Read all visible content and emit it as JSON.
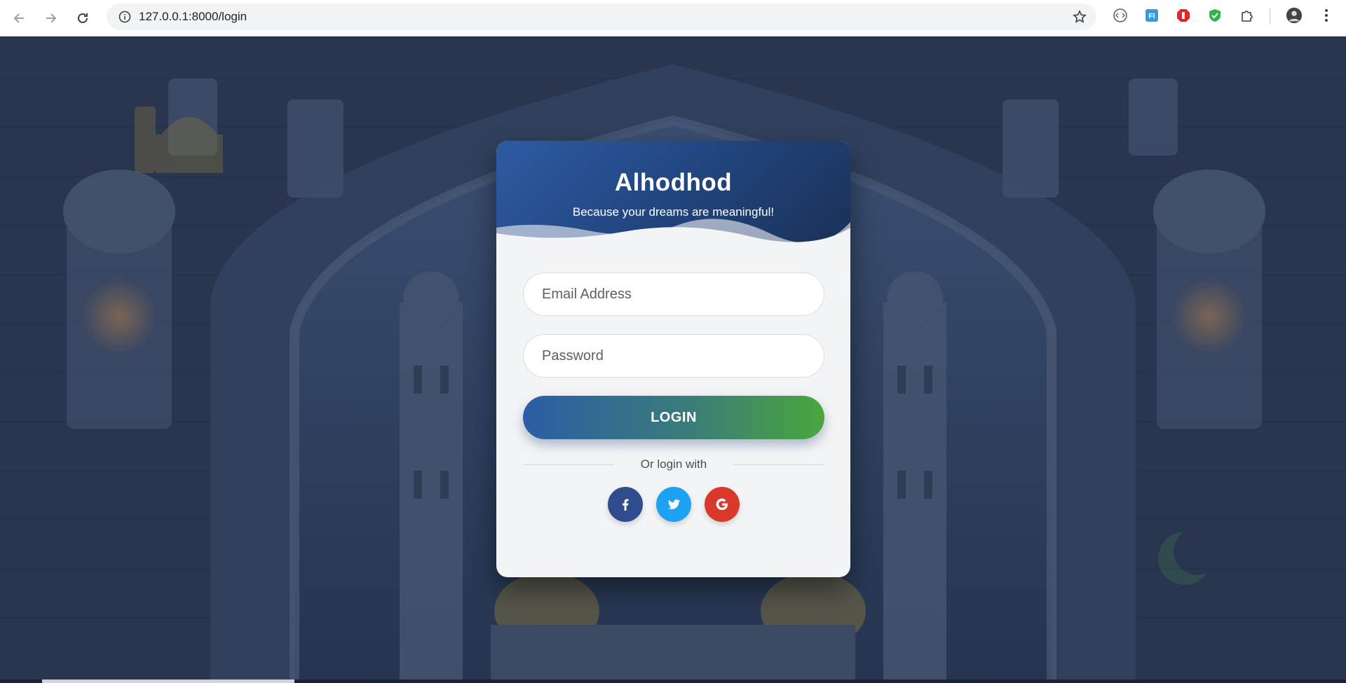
{
  "browser": {
    "url": "127.0.0.1:8000/login",
    "icons": [
      "back-icon",
      "forward-icon",
      "reload-icon",
      "site-info-icon",
      "bookmark-star-icon",
      "extension-icons",
      "profile-avatar",
      "menu-kebab-icon"
    ]
  },
  "card": {
    "brand": "Alhodhod",
    "tagline": "Because your dreams are meaningful!",
    "email_placeholder": "Email Address",
    "password_placeholder": "Password",
    "login_label": "LOGIN",
    "divider_text": "Or login with",
    "socials": [
      {
        "name": "facebook",
        "color": "#2f4c8c"
      },
      {
        "name": "twitter",
        "color": "#1da1f2"
      },
      {
        "name": "google",
        "color": "#d8392b"
      }
    ]
  },
  "colors": {
    "header_blue": "#2d5ba3",
    "button_gradient_start": "#2c5da6",
    "button_gradient_end": "#4aa63c",
    "card_bg": "#f3f4f6"
  }
}
